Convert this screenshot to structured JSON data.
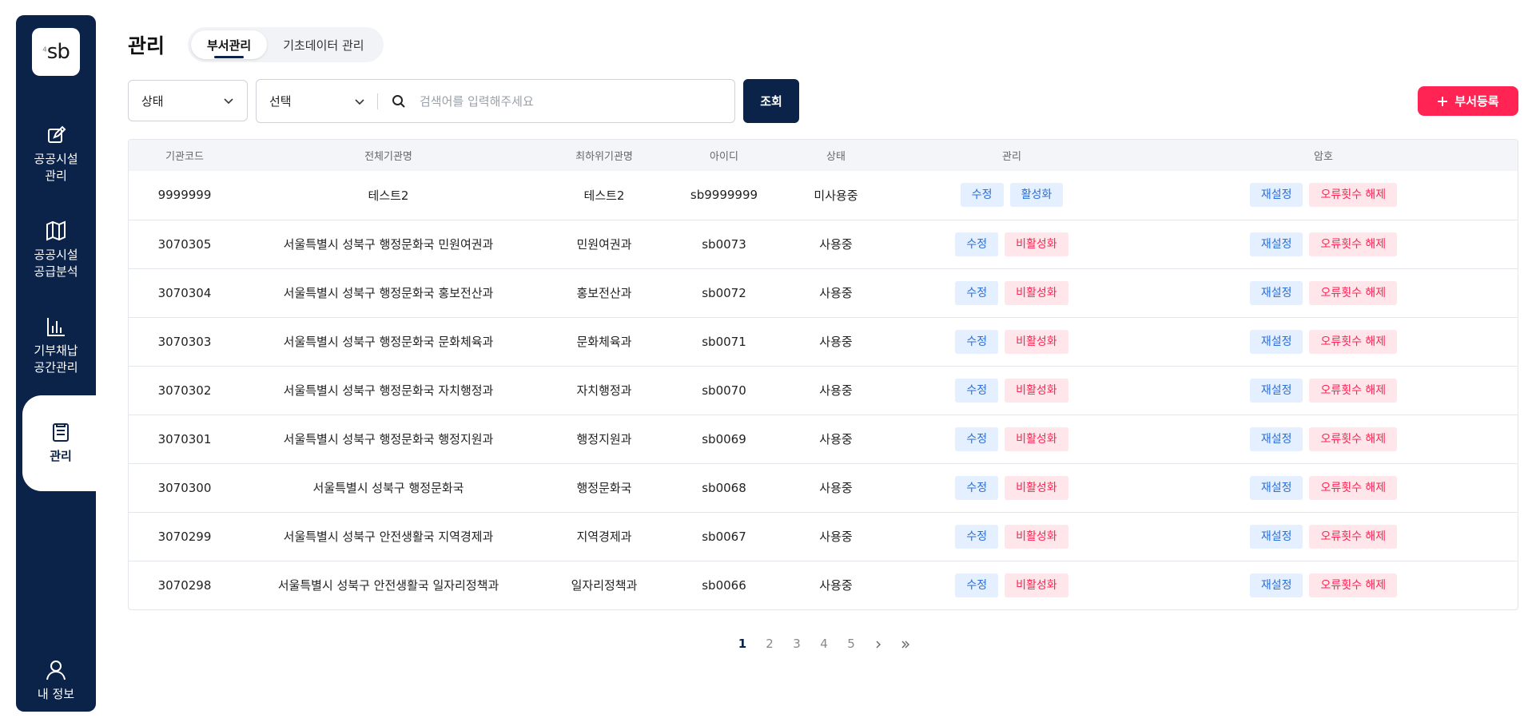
{
  "sidebar": {
    "logo": "sb",
    "items": [
      {
        "label": "공공시설\n관리",
        "icon": "edit-icon"
      },
      {
        "label": "공공시설\n공급분석",
        "icon": "map-icon"
      },
      {
        "label": "기부채납\n공간관리",
        "icon": "bar-chart-icon"
      },
      {
        "label": "관리",
        "icon": "clipboard-icon",
        "active": true
      },
      {
        "label": "내 정보",
        "icon": "user-icon"
      }
    ]
  },
  "header": {
    "title": "관리",
    "tabs": [
      {
        "label": "부서관리",
        "active": true
      },
      {
        "label": "기초데이터 관리",
        "active": false
      }
    ]
  },
  "filters": {
    "status_select": "상태",
    "field_select": "선택",
    "search_placeholder": "검색어를 입력해주세요",
    "search_button": "조회",
    "add_button": "부서등록"
  },
  "table": {
    "columns": [
      "기관코드",
      "전체기관명",
      "최하위기관명",
      "아이디",
      "상태",
      "관리",
      "암호"
    ],
    "rows": [
      {
        "code": "9999999",
        "full": "테스트2",
        "lowest": "테스트2",
        "id": "sb9999999",
        "status": "미사용중",
        "edit": "수정",
        "toggle": "활성화",
        "toggle_type": "blue",
        "reset": "재설정",
        "unlock": "오류횟수 해제"
      },
      {
        "code": "3070305",
        "full": "서울특별시 성북구 행정문화국 민원여권과",
        "lowest": "민원여권과",
        "id": "sb0073",
        "status": "사용중",
        "edit": "수정",
        "toggle": "비활성화",
        "toggle_type": "red",
        "reset": "재설정",
        "unlock": "오류횟수 해제"
      },
      {
        "code": "3070304",
        "full": "서울특별시 성북구 행정문화국 홍보전산과",
        "lowest": "홍보전산과",
        "id": "sb0072",
        "status": "사용중",
        "edit": "수정",
        "toggle": "비활성화",
        "toggle_type": "red",
        "reset": "재설정",
        "unlock": "오류횟수 해제"
      },
      {
        "code": "3070303",
        "full": "서울특별시 성북구 행정문화국 문화체육과",
        "lowest": "문화체육과",
        "id": "sb0071",
        "status": "사용중",
        "edit": "수정",
        "toggle": "비활성화",
        "toggle_type": "red",
        "reset": "재설정",
        "unlock": "오류횟수 해제"
      },
      {
        "code": "3070302",
        "full": "서울특별시 성북구 행정문화국 자치행정과",
        "lowest": "자치행정과",
        "id": "sb0070",
        "status": "사용중",
        "edit": "수정",
        "toggle": "비활성화",
        "toggle_type": "red",
        "reset": "재설정",
        "unlock": "오류횟수 해제"
      },
      {
        "code": "3070301",
        "full": "서울특별시 성북구 행정문화국 행정지원과",
        "lowest": "행정지원과",
        "id": "sb0069",
        "status": "사용중",
        "edit": "수정",
        "toggle": "비활성화",
        "toggle_type": "red",
        "reset": "재설정",
        "unlock": "오류횟수 해제"
      },
      {
        "code": "3070300",
        "full": "서울특별시 성북구 행정문화국",
        "lowest": "행정문화국",
        "id": "sb0068",
        "status": "사용중",
        "edit": "수정",
        "toggle": "비활성화",
        "toggle_type": "red",
        "reset": "재설정",
        "unlock": "오류횟수 해제"
      },
      {
        "code": "3070299",
        "full": "서울특별시 성북구 안전생활국 지역경제과",
        "lowest": "지역경제과",
        "id": "sb0067",
        "status": "사용중",
        "edit": "수정",
        "toggle": "비활성화",
        "toggle_type": "red",
        "reset": "재설정",
        "unlock": "오류횟수 해제"
      },
      {
        "code": "3070298",
        "full": "서울특별시 성북구 안전생활국 일자리정책과",
        "lowest": "일자리정책과",
        "id": "sb0066",
        "status": "사용중",
        "edit": "수정",
        "toggle": "비활성화",
        "toggle_type": "red",
        "reset": "재설정",
        "unlock": "오류횟수 해제"
      }
    ]
  },
  "pagination": {
    "pages": [
      "1",
      "2",
      "3",
      "4",
      "5"
    ],
    "current": "1",
    "next_icon": "chevron-right-icon",
    "last_icon": "double-chevron-right-icon"
  },
  "colors": {
    "navy": "#0b2249",
    "accent_red": "#ff2453",
    "chip_blue_bg": "#e4efff",
    "chip_blue_text": "#2b6fd6",
    "chip_red_bg": "#ffe6ea"
  }
}
